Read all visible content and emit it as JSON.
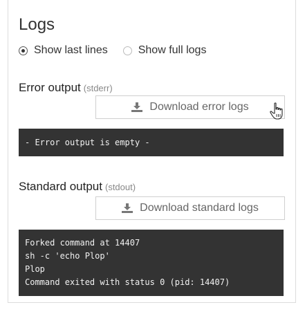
{
  "logs": {
    "title": "Logs",
    "view_options": [
      {
        "label": "Show last lines",
        "selected": true
      },
      {
        "label": "Show full logs",
        "selected": false
      }
    ],
    "error_section": {
      "title": "Error output",
      "subtitle": "(stderr)",
      "download_label": "Download error logs",
      "download_icon": "download-icon",
      "console_lines": [
        "- Error output is empty -"
      ]
    },
    "standard_section": {
      "title": "Standard output",
      "subtitle": "(stdout)",
      "download_label": "Download standard logs",
      "download_icon": "download-icon",
      "console_lines": [
        "Forked command at 14407",
        "sh -c 'echo Plop'",
        "Plop",
        "Command exited with status 0 (pid: 14407)"
      ]
    }
  },
  "colors": {
    "console_bg": "#333333",
    "console_text": "#f2f2f2",
    "button_border": "#cfcfcf",
    "muted_text": "#888888"
  }
}
